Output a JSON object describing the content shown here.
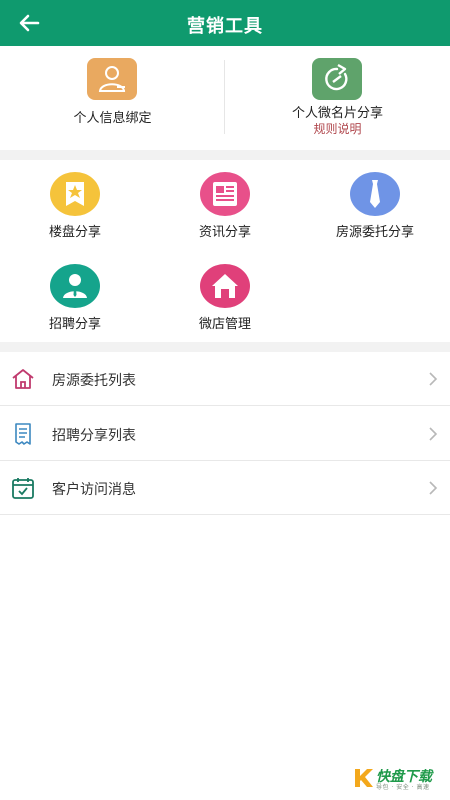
{
  "header": {
    "title": "营销工具"
  },
  "top_cards": [
    {
      "label": "个人信息绑定",
      "icon": "user-card-icon",
      "color": "#e9a960"
    },
    {
      "label": "个人微名片分享",
      "sublabel": "规则说明",
      "icon": "share-refresh-icon",
      "color": "#5fa36b"
    }
  ],
  "grid": [
    {
      "label": "楼盘分享",
      "icon": "star-badge-icon",
      "color": "#f5c33b"
    },
    {
      "label": "资讯分享",
      "icon": "news-icon",
      "color": "#e8508a"
    },
    {
      "label": "房源委托分享",
      "icon": "tie-icon",
      "color": "#6f94e6"
    },
    {
      "label": "招聘分享",
      "icon": "person-icon",
      "color": "#15a48c"
    },
    {
      "label": "微店管理",
      "icon": "house-icon",
      "color": "#e0407a"
    }
  ],
  "list": [
    {
      "label": "房源委托列表",
      "icon": "house-outline-icon",
      "color": "#c03a6e"
    },
    {
      "label": "招聘分享列表",
      "icon": "receipt-icon",
      "color": "#3c88c0"
    },
    {
      "label": "客户访问消息",
      "icon": "calendar-check-icon",
      "color": "#1a7a62"
    }
  ],
  "watermark": {
    "brand": "快盘下载",
    "slogan": "导包 · 安全 · 高速"
  }
}
